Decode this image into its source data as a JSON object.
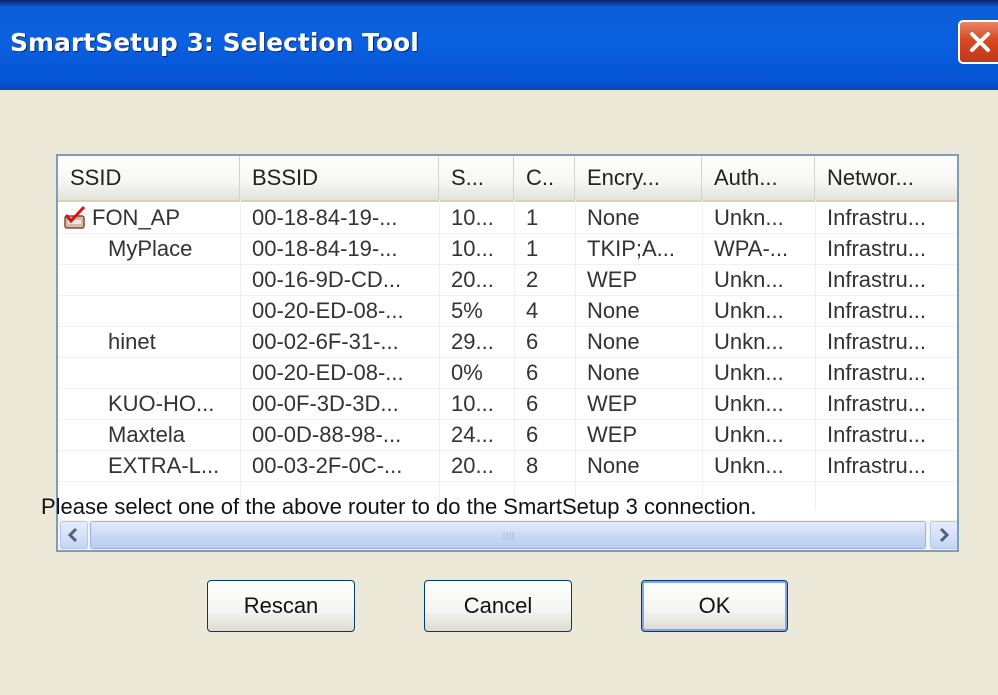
{
  "window": {
    "title": "SmartSetup 3: Selection Tool"
  },
  "list": {
    "columns": [
      "SSID",
      "BSSID",
      "S...",
      "C..",
      "Encry...",
      "Auth...",
      "Networ..."
    ],
    "rows": [
      {
        "checked": true,
        "cells": [
          "FON_AP",
          "00-18-84-19-...",
          "10...",
          "1",
          "None",
          "Unkn...",
          "Infrastru..."
        ]
      },
      {
        "checked": false,
        "cells": [
          "MyPlace",
          "00-18-84-19-...",
          "10...",
          "1",
          "TKIP;A...",
          "WPA-...",
          "Infrastru..."
        ]
      },
      {
        "checked": false,
        "cells": [
          "",
          "00-16-9D-CD...",
          "20...",
          "2",
          "WEP",
          "Unkn...",
          "Infrastru..."
        ]
      },
      {
        "checked": false,
        "cells": [
          "",
          "00-20-ED-08-...",
          "5%",
          "4",
          "None",
          "Unkn...",
          "Infrastru..."
        ]
      },
      {
        "checked": false,
        "cells": [
          "hinet",
          "00-02-6F-31-...",
          "29...",
          "6",
          "None",
          "Unkn...",
          "Infrastru..."
        ]
      },
      {
        "checked": false,
        "cells": [
          "",
          "00-20-ED-08-...",
          "0%",
          "6",
          "None",
          "Unkn...",
          "Infrastru..."
        ]
      },
      {
        "checked": false,
        "cells": [
          "KUO-HO...",
          "00-0F-3D-3D...",
          "10...",
          "6",
          "WEP",
          "Unkn...",
          "Infrastru..."
        ]
      },
      {
        "checked": false,
        "cells": [
          "Maxtela",
          "00-0D-88-98-...",
          "24...",
          "6",
          "WEP",
          "Unkn...",
          "Infrastru..."
        ]
      },
      {
        "checked": false,
        "cells": [
          "EXTRA-L...",
          "00-03-2F-0C-...",
          "20...",
          "8",
          "None",
          "Unkn...",
          "Infrastru..."
        ]
      }
    ]
  },
  "message": "Please select one of the above router to do the SmartSetup 3 connection.",
  "buttons": {
    "rescan": "Rescan",
    "cancel": "Cancel",
    "ok": "OK"
  },
  "icons": {
    "close": "close-icon",
    "checked_row": "check-network-icon",
    "scroll_left": "arrow-left-icon",
    "scroll_right": "arrow-right-icon"
  }
}
